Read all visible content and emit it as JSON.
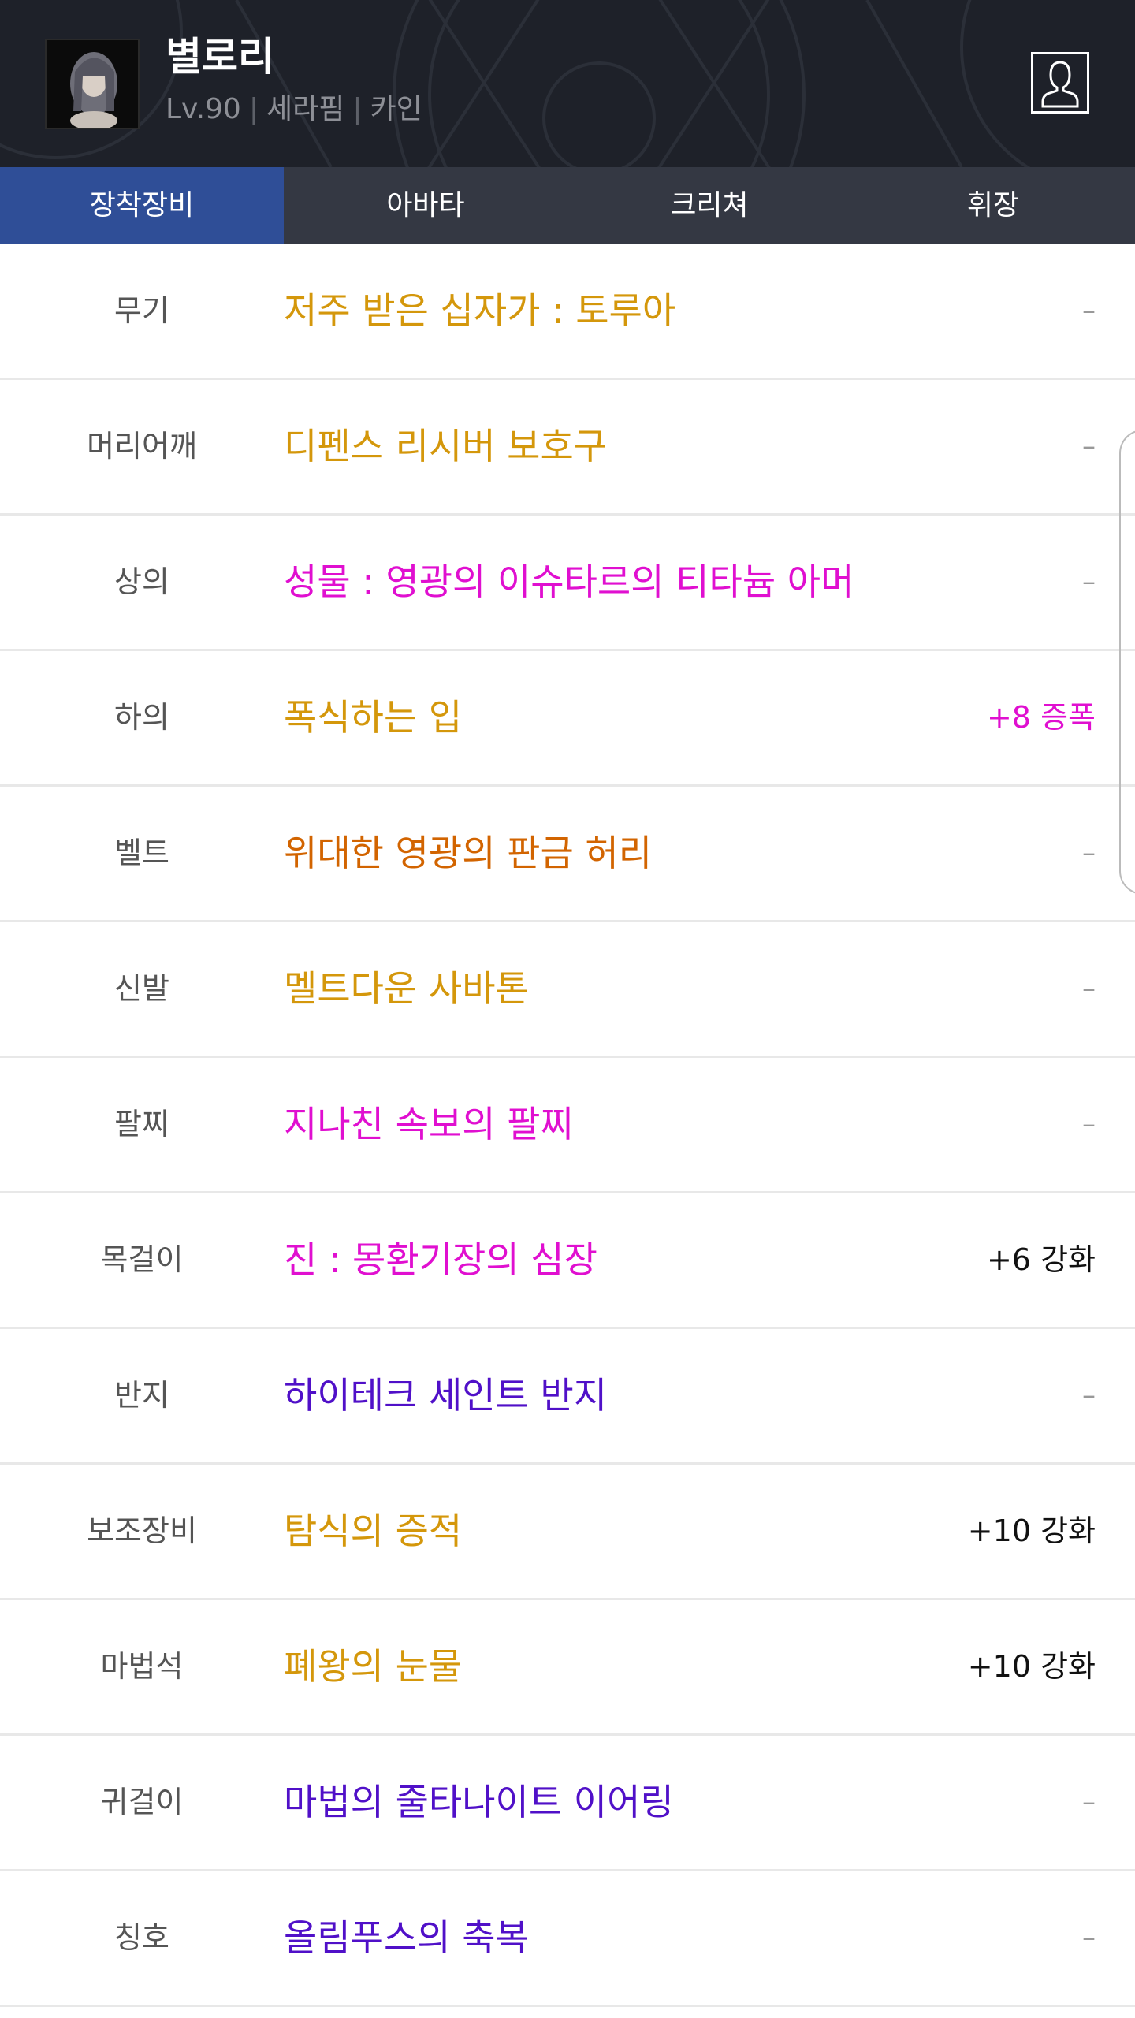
{
  "header": {
    "character_name": "별로리",
    "level": "Lv.90",
    "job": "세라핌",
    "server": "카인",
    "separator": "|"
  },
  "tabs": [
    {
      "label": "장착장비",
      "active": true
    },
    {
      "label": "아바타",
      "active": false
    },
    {
      "label": "크리쳐",
      "active": false
    },
    {
      "label": "휘장",
      "active": false
    }
  ],
  "colors": {
    "epic": "#d4970b",
    "legendary": "#e00fd0",
    "unique": "#d26400",
    "rare": "#5010c8",
    "header_bg": "#1e2129",
    "tab_bg": "#343843",
    "tab_active": "#2f4e97"
  },
  "equipment": [
    {
      "slot": "무기",
      "name": "저주 받은 십자가 : 토루아",
      "enhance": "–",
      "color": "#d4970b"
    },
    {
      "slot": "머리어깨",
      "name": "디펜스 리시버 보호구",
      "enhance": "–",
      "color": "#d4970b"
    },
    {
      "slot": "상의",
      "name": "성물 : 영광의 이슈타르의 티타늄 아머",
      "enhance": "–",
      "color": "#e00fd0"
    },
    {
      "slot": "하의",
      "name": "폭식하는 입",
      "enhance": "+8 증폭",
      "color": "#d4970b",
      "enhance_color": "#e00fd0"
    },
    {
      "slot": "벨트",
      "name": "위대한 영광의 판금 허리",
      "enhance": "–",
      "color": "#d26400"
    },
    {
      "slot": "신발",
      "name": "멜트다운 사바톤",
      "enhance": "–",
      "color": "#d4970b"
    },
    {
      "slot": "팔찌",
      "name": "지나친 속보의 팔찌",
      "enhance": "–",
      "color": "#e00fd0"
    },
    {
      "slot": "목걸이",
      "name": "진 : 몽환기장의 심장",
      "enhance": "+6 강화",
      "color": "#e00fd0"
    },
    {
      "slot": "반지",
      "name": "하이테크 세인트 반지",
      "enhance": "–",
      "color": "#5010c8"
    },
    {
      "slot": "보조장비",
      "name": "탐식의 증적",
      "enhance": "+10 강화",
      "color": "#d4970b"
    },
    {
      "slot": "마법석",
      "name": "폐왕의 눈물",
      "enhance": "+10 강화",
      "color": "#d4970b"
    },
    {
      "slot": "귀걸이",
      "name": "마법의 줄타나이트 이어링",
      "enhance": "–",
      "color": "#5010c8"
    },
    {
      "slot": "칭호",
      "name": "올림푸스의 축복",
      "enhance": "–",
      "color": "#5010c8"
    }
  ]
}
